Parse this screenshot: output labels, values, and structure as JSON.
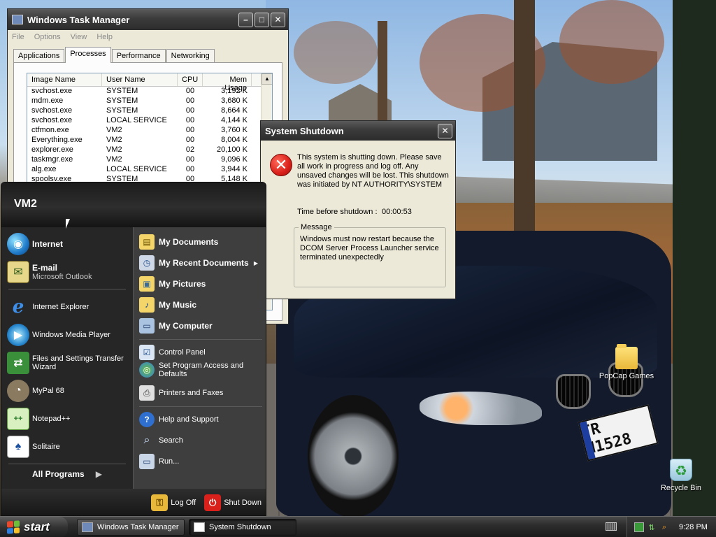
{
  "desktop": {
    "icons": {
      "popcap": "PopCap Games",
      "recycle": "Recycle Bin"
    },
    "plate_text": "TR N1528"
  },
  "taskmgr": {
    "title": "Windows Task Manager",
    "menu": [
      "File",
      "Options",
      "View",
      "Help"
    ],
    "tabs": [
      "Applications",
      "Processes",
      "Performance",
      "Networking"
    ],
    "active_tab": "Processes",
    "columns": [
      "Image Name",
      "User Name",
      "CPU",
      "Mem Usage"
    ],
    "rows": [
      [
        "svchost.exe",
        "SYSTEM",
        "00",
        "3,192 K"
      ],
      [
        "mdm.exe",
        "SYSTEM",
        "00",
        "3,680 K"
      ],
      [
        "svchost.exe",
        "SYSTEM",
        "00",
        "8,664 K"
      ],
      [
        "svchost.exe",
        "LOCAL SERVICE",
        "00",
        "4,144 K"
      ],
      [
        "ctfmon.exe",
        "VM2",
        "00",
        "3,760 K"
      ],
      [
        "Everything.exe",
        "VM2",
        "00",
        "8,004 K"
      ],
      [
        "explorer.exe",
        "VM2",
        "02",
        "20,100 K"
      ],
      [
        "taskmgr.exe",
        "VM2",
        "00",
        "9,096 K"
      ],
      [
        "alg.exe",
        "LOCAL SERVICE",
        "00",
        "3,944 K"
      ],
      [
        "spoolsv.exe",
        "SYSTEM",
        "00",
        "5,148 K"
      ]
    ]
  },
  "shutdown": {
    "title": "System Shutdown",
    "text": "This system is shutting down. Please save all work in progress and log off. Any unsaved changes will be lost. This shutdown was initiated by NT AUTHORITY\\SYSTEM",
    "time_label": "Time before shutdown :",
    "time_value": "00:00:53",
    "message_legend": "Message",
    "message": "Windows must now restart because the DCOM Server Process Launcher service terminated unexpectedly"
  },
  "startmenu": {
    "user": "VM2",
    "pinned": [
      {
        "label": "Internet",
        "sub": ""
      },
      {
        "label": "E-mail",
        "sub": "Microsoft Outlook"
      }
    ],
    "recent": [
      {
        "label": "Internet Explorer"
      },
      {
        "label": "Windows Media Player"
      },
      {
        "label": "Files and Settings Transfer Wizard"
      },
      {
        "label": "MyPal 68"
      },
      {
        "label": "Notepad++"
      },
      {
        "label": "Solitaire"
      }
    ],
    "all_programs": "All Programs",
    "right": {
      "my_documents": "My Documents",
      "my_recent_documents": "My Recent Documents",
      "my_pictures": "My Pictures",
      "my_music": "My Music",
      "my_computer": "My Computer",
      "control_panel": "Control Panel",
      "set_program_access": "Set Program Access and Defaults",
      "printers_faxes": "Printers and Faxes",
      "help_support": "Help and Support",
      "search": "Search",
      "run": "Run..."
    },
    "log_off": "Log Off",
    "shut_down": "Shut Down"
  },
  "taskbar": {
    "start": "start",
    "tasks": [
      {
        "label": "Windows Task Manager",
        "active": false
      },
      {
        "label": "System Shutdown",
        "active": true
      }
    ],
    "clock": "9:28 PM"
  },
  "colors": {
    "error_red": "#d9201a",
    "taskbar_dark": "#2d2d2d",
    "xp_flag": [
      "#e8482c",
      "#6dbf3b",
      "#2f7fdf",
      "#f6c12a"
    ]
  }
}
